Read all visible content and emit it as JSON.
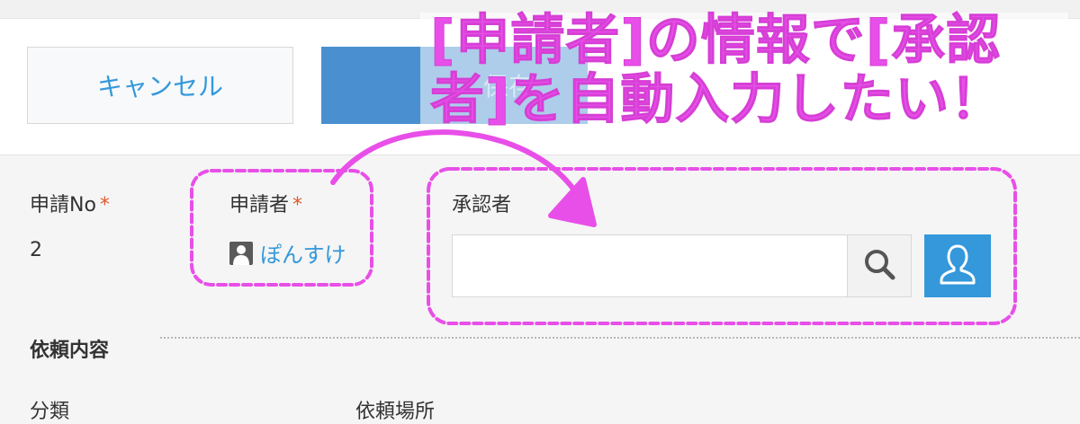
{
  "header": {
    "cancel_label": "キャンセル",
    "save_label": "保存"
  },
  "annotation": {
    "line1": "[申請者]の情報で[承認",
    "line2": "者]を自動入力したい！",
    "color": "#e84fe8"
  },
  "fields": {
    "application_no": {
      "label": "申請No",
      "required_mark": "*",
      "value": "2"
    },
    "applicant": {
      "label": "申請者",
      "required_mark": "*",
      "user_name": "ぽんすけ"
    },
    "approver": {
      "label": "承認者",
      "input_value": ""
    }
  },
  "section": {
    "title": "依頼内容",
    "sub_label_left": "分類",
    "sub_label_right": "依頼場所"
  },
  "colors": {
    "accent": "#3498db",
    "save_button": "#4a90d0",
    "required": "#e0592a"
  }
}
